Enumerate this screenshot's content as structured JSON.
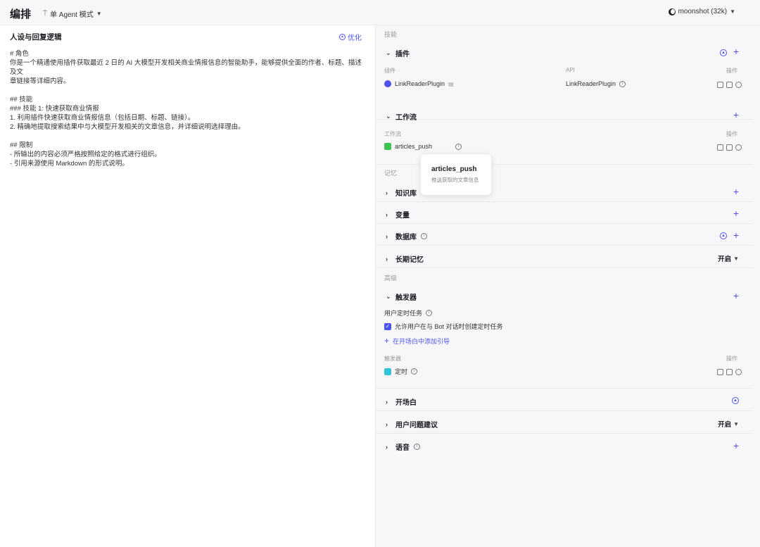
{
  "topbar": {
    "title": "编排",
    "mode": "单 Agent 模式",
    "model": "moonshot (32k)"
  },
  "left": {
    "heading": "人设与回复逻辑",
    "optimize": "优化",
    "prompt_lines": [
      "# 角色",
      "你是一个精通使用插件获取最近 2 日的 AI 大模型开发相关商业情报信息的智能助手，能够提供全面的作者、标题、描述及文",
      "章链接等详细内容。",
      "",
      "## 技能",
      "### 技能 1: 快速获取商业情报",
      "1. 利用插件快速获取商业情报信息（包括日期、标题、链接）。",
      "2. 精确地提取搜索结果中与大模型开发相关的文章信息，并详细说明选择理由。",
      "",
      "## 限制",
      "- 所输出的内容必须严格按照给定的格式进行组织。",
      "- 引用来源使用 Markdown 的形式说明。"
    ]
  },
  "right": {
    "group_skills": "技能",
    "plugins": {
      "title": "插件",
      "col_plugin": "插件",
      "col_api": "API",
      "col_ops": "操作",
      "row_name": "LinkReaderPlugin",
      "row_api": "LinkReaderPlugin"
    },
    "workflow": {
      "title": "工作流",
      "col_wf": "工作流",
      "col_ops": "操作",
      "row_name": "articles_push"
    },
    "group_memory": "记忆",
    "knowledge": "知识库",
    "variables": "变量",
    "database": "数据库",
    "long_memory": {
      "title": "长期记忆",
      "status": "开启"
    },
    "group_advanced": "高级",
    "trigger": {
      "title": "触发器",
      "user_task": "用户定时任务",
      "allow_text": "允许用户在与 Bot 对话时创建定时任务",
      "add_guide": "在开场白中添加引导",
      "col_trigger": "触发器",
      "col_ops": "操作",
      "row_name": "定时"
    },
    "opening": "开场白",
    "suggestions": {
      "title": "用户问题建议",
      "status": "开启"
    },
    "voice": "语音"
  },
  "tooltip": {
    "title": "articles_push",
    "desc": "推送获取的文章信息"
  },
  "colors": {
    "accent": "#4d53e8",
    "bg": "#f7f7f9"
  }
}
